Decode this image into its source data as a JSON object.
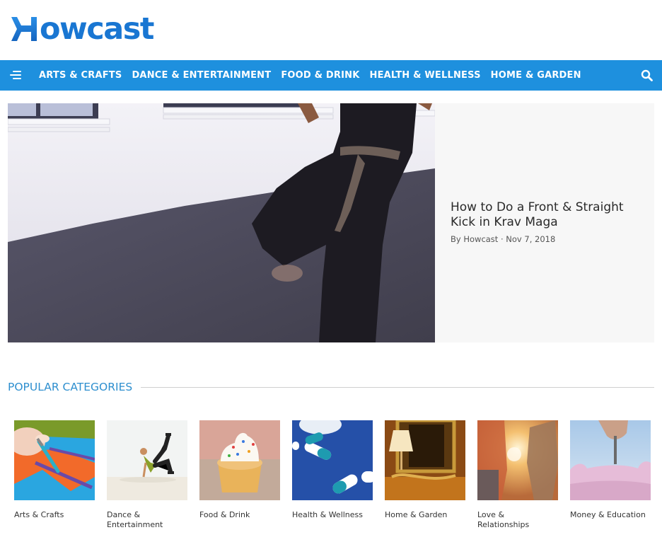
{
  "brand": {
    "name": "Howcast",
    "logo_rest": "owcast",
    "primary_color": "#1976d2",
    "nav_color": "#1e90de",
    "section_color": "#2e8fcf"
  },
  "nav": {
    "menu_icon": "hamburger-icon",
    "items": [
      {
        "label": "ARTS & CRAFTS"
      },
      {
        "label": "DANCE & ENTERTAINMENT"
      },
      {
        "label": "FOOD & DRINK"
      },
      {
        "label": "HEALTH & WELLNESS"
      },
      {
        "label": "HOME & GARDEN"
      }
    ],
    "search_icon": "search-icon"
  },
  "hero": {
    "image_alt": "Person in black martial arts uniform with brown belt kicking in a studio",
    "title": "How to Do a Front & Straight Kick in Krav Maga",
    "meta": "By Howcast · Nov 7, 2018"
  },
  "popular": {
    "title": "POPULAR CATEGORIES",
    "categories": [
      {
        "label": "Arts & Crafts",
        "image": "painting"
      },
      {
        "label": "Dance & Entertainment",
        "image": "breakdancer"
      },
      {
        "label": "Food & Drink",
        "image": "cupcake"
      },
      {
        "label": "Health & Wellness",
        "image": "pills"
      },
      {
        "label": "Home & Garden",
        "image": "lamp-mirror"
      },
      {
        "label": "Love & Relationships",
        "image": "couple"
      },
      {
        "label": "Money & Education",
        "image": "piggy-bank"
      }
    ]
  }
}
